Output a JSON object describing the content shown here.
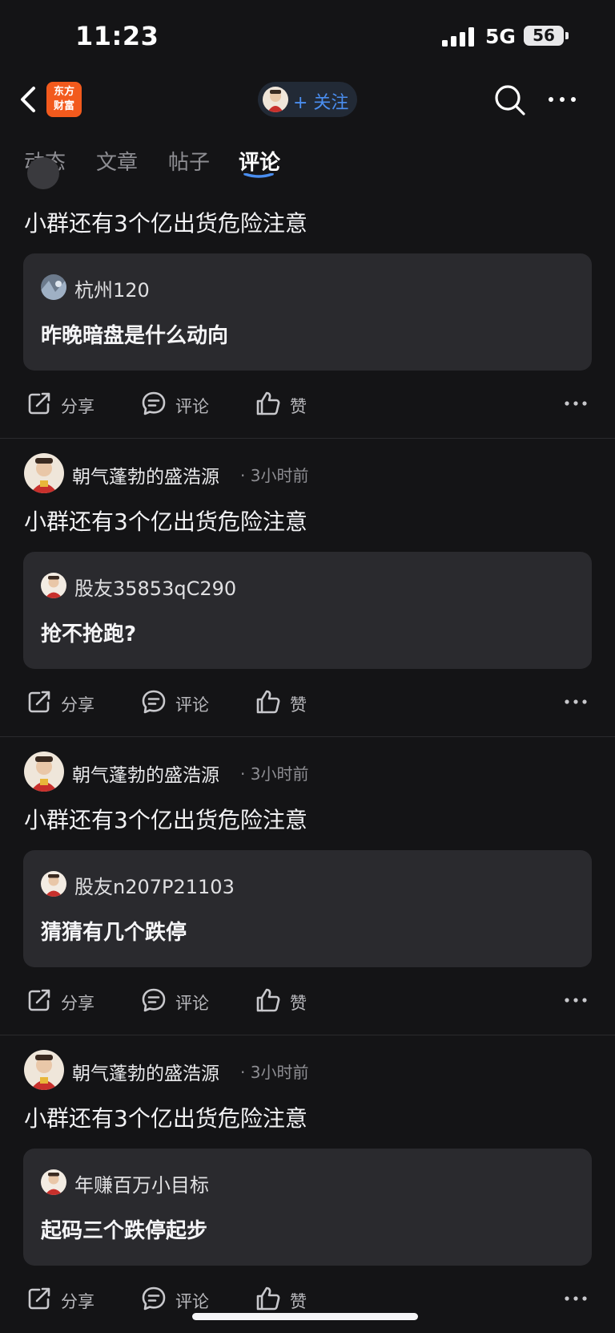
{
  "status_bar": {
    "time": "11:23",
    "network": "5G",
    "battery": "56"
  },
  "nav": {
    "logo_text": "东方财富",
    "follow_label": "+ 关注"
  },
  "tabs": [
    {
      "label": "动态",
      "active": false
    },
    {
      "label": "文章",
      "active": false
    },
    {
      "label": "帖子",
      "active": false
    },
    {
      "label": "评论",
      "active": true
    }
  ],
  "actions": {
    "share": "分享",
    "comment": "评论",
    "like": "赞"
  },
  "posts": [
    {
      "author": "",
      "time": "",
      "text": "小群还有3个亿出货危险注意",
      "quote": {
        "user": "杭州120",
        "text": "昨晚暗盘是什么动向"
      }
    },
    {
      "author": "朝气蓬勃的盛浩源",
      "time": "3小时前",
      "text": "小群还有3个亿出货危险注意",
      "quote": {
        "user": "股友35853qC290",
        "text": "抢不抢跑?"
      }
    },
    {
      "author": "朝气蓬勃的盛浩源",
      "time": "3小时前",
      "text": "小群还有3个亿出货危险注意",
      "quote": {
        "user": "股友n207P21103",
        "text": "猜猜有几个跌停"
      }
    },
    {
      "author": "朝气蓬勃的盛浩源",
      "time": "3小时前",
      "text": "小群还有3个亿出货危险注意",
      "quote": {
        "user": "年赚百万小目标",
        "text": "起码三个跌停起步"
      }
    }
  ],
  "colors": {
    "accent": "#4a8ef0",
    "logo": "#f25a1d",
    "background": "#141416",
    "card": "#2a2a2e"
  }
}
